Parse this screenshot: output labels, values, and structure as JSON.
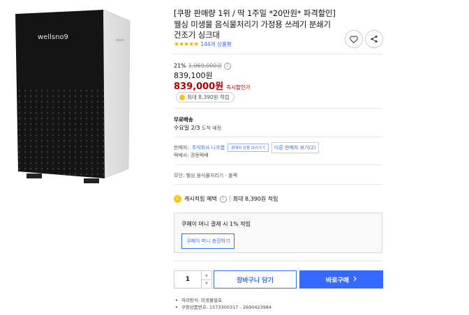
{
  "product": {
    "image_brand_text": "wellsno9",
    "title": "[쿠팡 판매량 1위 / 딱 1주일 *20만원* 파격할인] 웰싱 미생물 음식물처리기 가정용 쓰레기 분쇄기 건조기 싱크대",
    "review_count": "144개 상품평",
    "discount_pct": "21%",
    "strike_price": "1,069,000원",
    "orig_price": "839,100원",
    "final_price": "839,000원",
    "final_label": "즉시할인가",
    "reward_badge": "최대 8,390원 적립"
  },
  "shipping": {
    "title": "무료배송",
    "date": "수요일 2/3",
    "date_suffix": "도착 예정"
  },
  "seller": {
    "label": "판매자:",
    "name": "주식회사 니즈랩",
    "tip": "판매자 상품 보러가기",
    "other": "다른 판매자 보기(2)",
    "carrier": "택배사: 경동택배"
  },
  "option": "모던: 웰싱 음식물처리기 - 블랙",
  "cash": {
    "label": "캐시적립 혜택",
    "amount": "최대 8,390원 적립"
  },
  "pay": {
    "text": "쿠페이 머니 결제 시 1% 적립",
    "button": "쿠페이 머니 충전하기"
  },
  "purchase": {
    "qty": "1",
    "cart": "장바구니 담기",
    "buy": "바로구매"
  },
  "details": [
    "처리방식: 미생물발효",
    "쿠팡상품번호: 1573300317 - 2690423984"
  ],
  "colors": {
    "accent": "#346aff",
    "price_red": "#ae0000",
    "star": "#f5a623"
  },
  "icons": [
    "heart-icon",
    "share-icon",
    "star-icon",
    "info-icon",
    "coin-icon",
    "chevron-right-icon"
  ]
}
